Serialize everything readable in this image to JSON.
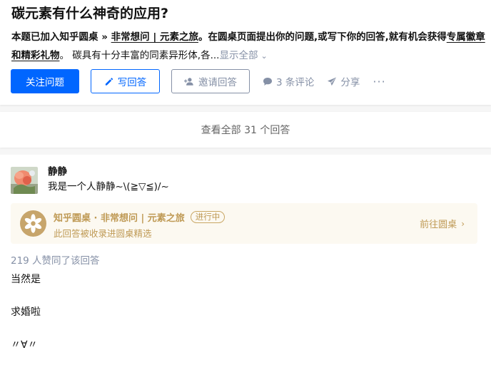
{
  "question": {
    "title": "碳元素有什么神奇的应用?",
    "desc_prefix": "本题已加入知乎圆桌 » ",
    "desc_link": "非常想问 | 元素之旅",
    "desc_mid": "。在圆桌页面提出你的问题,或写下你的回答,就有机会获得",
    "desc_bold": "专属徽章和精彩礼物",
    "desc_rest": "。 碳具有十分丰富的同素异形体,各...",
    "show_all": "显示全部"
  },
  "actions": {
    "follow": "关注问题",
    "write": "写回答",
    "invite": "邀请回答",
    "comments": "3 条评论",
    "share": "分享",
    "more": "···"
  },
  "view_all": "查看全部 31 个回答",
  "answer": {
    "author": "静静",
    "bio": "我是一个人静静~\\(≧▽≦)/~",
    "roundtable": {
      "title": "知乎圆桌 · 非常想问 | 元素之旅",
      "status": "进行中",
      "subtitle": "此回答被收录进圆桌精选",
      "go": "前往圆桌"
    },
    "votes": "219 人赞同了该回答",
    "lines": [
      "当然是",
      "求婚啦",
      "〃∀〃"
    ]
  },
  "colors": {
    "primary": "#0066ff",
    "muted": "#8590a6",
    "gold": "#bf9a55"
  }
}
